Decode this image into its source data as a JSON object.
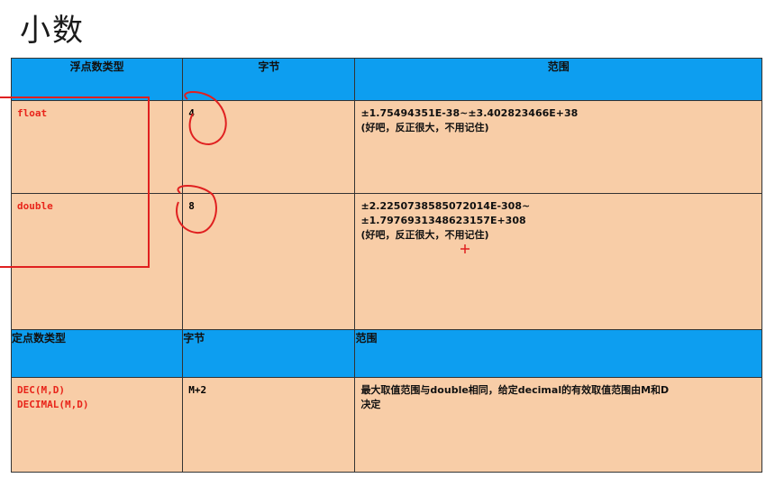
{
  "title": "小数",
  "float_header": {
    "type": "浮点数类型",
    "bytes": "字节",
    "range": "范围"
  },
  "float_rows": [
    {
      "type": "float",
      "bytes": "4",
      "range_lines": [
        "±1.75494351E-38~±3.402823466E+38",
        "(好吧，反正很大，不用记住)"
      ]
    },
    {
      "type": "double",
      "bytes": "8",
      "range_lines": [
        "±2.2250738585072014E-308~",
        "±1.7976931348623157E+308",
        "(好吧，反正很大，不用记住)"
      ]
    }
  ],
  "fixed_header": {
    "type": "定点数类型",
    "bytes": "字节",
    "range": "范围"
  },
  "fixed_rows": [
    {
      "type_lines": [
        "DEC(M,D)",
        "DECIMAL(M,D)"
      ],
      "bytes": "M+2",
      "range_lines": [
        "最大取值范围与double相同，给定decimal的有效取值范围由M和D",
        "决定"
      ]
    }
  ],
  "colors": {
    "header_bg": "#0d9ef0",
    "body_bg": "#f8cda7",
    "type_text": "#e8241a",
    "annotation": "#e02020"
  }
}
